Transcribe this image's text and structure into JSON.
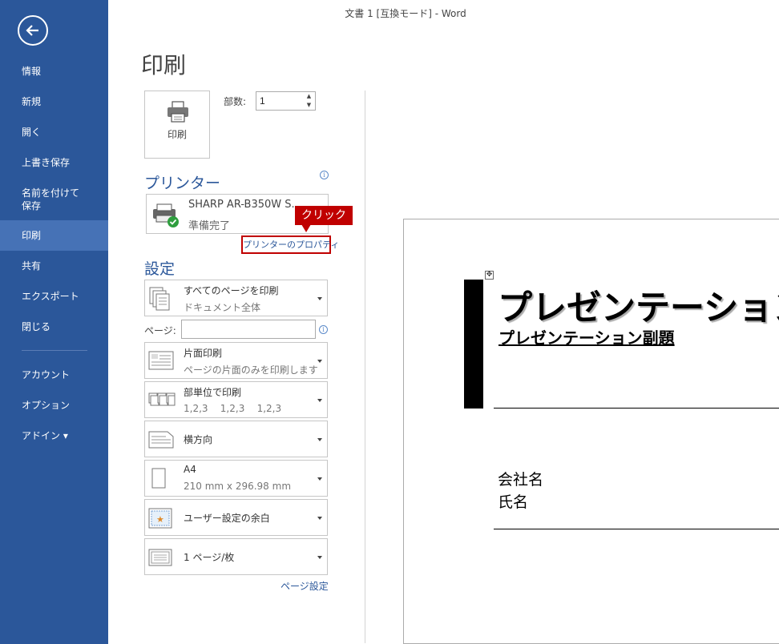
{
  "window": {
    "title": "文書 1 [互換モード] - Word"
  },
  "sidebar": {
    "items": [
      {
        "label": "情報"
      },
      {
        "label": "新規"
      },
      {
        "label": "開く"
      },
      {
        "label": "上書き保存"
      },
      {
        "label": "名前を付けて\n保存"
      },
      {
        "label": "印刷",
        "active": true
      },
      {
        "label": "共有"
      },
      {
        "label": "エクスポート"
      },
      {
        "label": "閉じる"
      },
      {
        "label": "アカウント"
      },
      {
        "label": "オプション"
      },
      {
        "label": "アドイン ▾"
      }
    ]
  },
  "print": {
    "page_title": "印刷",
    "print_button_label": "印刷",
    "copies_label": "部数:",
    "copies_value": "1"
  },
  "printer": {
    "heading": "プリンター",
    "name": "SHARP AR-B350W S...",
    "status": "準備完了",
    "properties_link": "プリンターのプロパティ",
    "callout": "クリック"
  },
  "settings": {
    "heading": "設定",
    "pages_label": "ページ:",
    "pages_value": "",
    "items": [
      {
        "main": "すべてのページを印刷",
        "sub": "ドキュメント全体",
        "icon": "pages-stack-icon"
      },
      {
        "main": "片面印刷",
        "sub": "ページの片面のみを印刷します",
        "icon": "one-sided-icon"
      },
      {
        "main": "部単位で印刷",
        "sub": "1,2,3    1,2,3    1,2,3",
        "icon": "collate-icon"
      },
      {
        "main": "横方向",
        "sub": "",
        "icon": "landscape-icon"
      },
      {
        "main": "A4",
        "sub": "210 mm x 296.98 mm",
        "icon": "paper-size-icon"
      },
      {
        "main": "ユーザー設定の余白",
        "sub": "",
        "icon": "margins-icon"
      },
      {
        "main": "1 ページ/枚",
        "sub": "",
        "icon": "pages-per-sheet-icon"
      }
    ],
    "page_setup_link": "ページ設定"
  },
  "preview": {
    "title": "プレゼンテーション",
    "subtitle": "プレゼンテーション副題",
    "company": "会社名",
    "person": "氏名"
  },
  "colors": {
    "sidebar": "#2b579a",
    "sidebar_active": "#4672b6",
    "callout": "#c00000"
  }
}
